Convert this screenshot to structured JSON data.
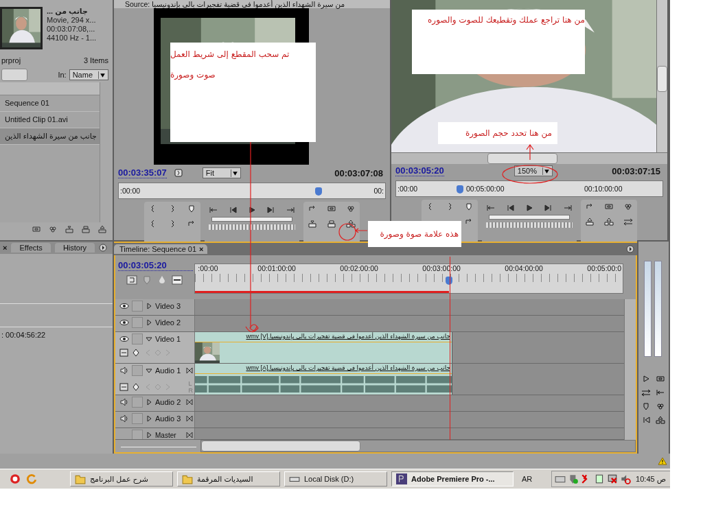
{
  "project": {
    "clip_info": [
      "... جانب من",
      "Movie, 294 x...",
      "00:03:07:08,...",
      "44100 Hz - 1..."
    ],
    "file": "prproj",
    "count": "3 Items",
    "in_label": "In:",
    "in_value": "Name",
    "items": [
      {
        "label": "Sequence 01",
        "selected": false
      },
      {
        "label": "Untitled Clip 01.avi",
        "selected": false
      },
      {
        "label": "جانب من سيرة الشهداء الذين",
        "selected": true
      }
    ]
  },
  "source": {
    "title": "Source: من سيرة الشهداء الذين أعدموا في قضية تفجيرات بالي بإندونيسيا",
    "timecode": "00:03:35:07",
    "zoom": "Fit",
    "duration": "00:03:07:08",
    "ruler": [
      ":00:00",
      "00:"
    ],
    "playhead": {
      "level": 0.75
    }
  },
  "program": {
    "timecode": "00:03:05:20",
    "zoom": "150%",
    "duration": "00:03:07:15",
    "ruler": [
      ":00:00",
      "00:05:00:00",
      "00:10:00:00"
    ],
    "playhead": {
      "level": 0.24
    }
  },
  "lower_left": {
    "close": "×",
    "tabs": [
      "Effects",
      "History"
    ],
    "duration": ": 00:04:56:22"
  },
  "timeline": {
    "tab": "Timeline: Sequence 01",
    "close": "×",
    "timecode": "00:03:05:20",
    "ruler": [
      ":00:00",
      "00:01:00:00",
      "00:02:00:00",
      "00:03:00:00",
      "00:04:00:00",
      "00:05:00:0"
    ],
    "playhead": {
      "level": 0.593
    },
    "tracks": [
      {
        "name": "Video 3",
        "kind": "video",
        "expanded": false
      },
      {
        "name": "Video 2",
        "kind": "video",
        "expanded": false
      },
      {
        "name": "Video 1",
        "kind": "video",
        "expanded": true,
        "clip": "جانب من سيرة الشهداء الذين أعدموا في قضية تفجيرات بالي بإندونيسيا.wmv [V]"
      },
      {
        "name": "Audio 1",
        "kind": "audio",
        "expanded": true,
        "clip": "جانب من سيرة الشهداء الذين أعدموا في قضية تفجيرات بالي بإندونيسيا.wmv [A]",
        "channels": [
          "L",
          "R"
        ]
      },
      {
        "name": "Audio 2",
        "kind": "audio",
        "expanded": false
      },
      {
        "name": "Audio 3",
        "kind": "audio",
        "expanded": false
      },
      {
        "name": "Master",
        "kind": "master",
        "expanded": false
      }
    ]
  },
  "annotations": [
    {
      "lines": [
        "تم سحب المقطع إلى شريط العمل",
        "صوت وصورة"
      ]
    },
    {
      "lines": [
        "من هنا تراجع عملك وتقطيعك للصوت والصوره"
      ]
    },
    {
      "lines": [
        "من هنا تحدد حجم الصورة"
      ]
    },
    {
      "lines": [
        "هذه علامة صوة وصورة"
      ]
    }
  ],
  "taskbar": {
    "items": [
      {
        "label": "شرح عمل البرنامج",
        "kind": "folder",
        "selected": false
      },
      {
        "label": "السيديات المرقمة",
        "kind": "folder",
        "selected": false
      },
      {
        "label": "Local Disk (D:)",
        "kind": "drive",
        "selected": false
      },
      {
        "label": "Adobe Premiere Pro -...",
        "kind": "app",
        "selected": true
      }
    ],
    "language": "AR",
    "clock": "10:45 ص"
  }
}
